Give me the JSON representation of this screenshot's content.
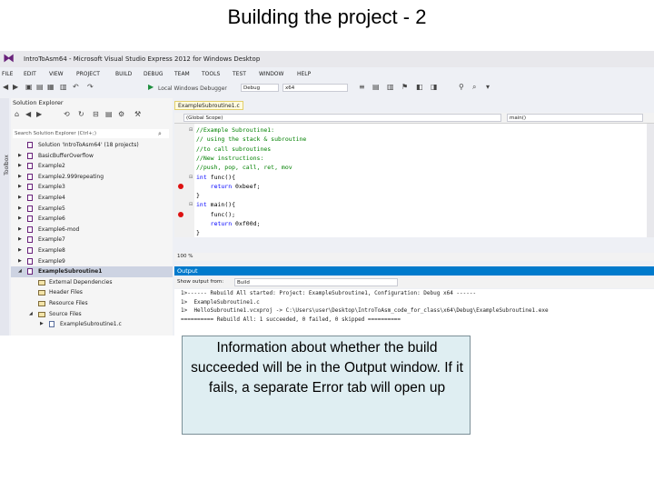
{
  "slide": {
    "title": "Building the project - 2",
    "callout": "Information about whether the build succeeded will be in the Output window. If it fails, a separate Error tab will open up"
  },
  "window": {
    "title": "IntroToAsm64 - Microsoft Visual Studio Express 2012 for Windows Desktop",
    "logo_icon": "visual-studio-logo"
  },
  "menu": [
    "FILE",
    "EDIT",
    "VIEW",
    "PROJECT",
    "BUILD",
    "DEBUG",
    "TEAM",
    "TOOLS",
    "TEST",
    "WINDOW",
    "HELP"
  ],
  "toolbar": {
    "debugger": "Local Windows Debugger",
    "config": "Debug",
    "platform": "x64"
  },
  "toolbox": {
    "label": "Toolbox"
  },
  "solution_explorer": {
    "title": "Solution Explorer",
    "search_placeholder": "Search Solution Explorer (Ctrl+;)",
    "items": [
      {
        "label": "Solution 'IntroToAsm64' (18 projects)",
        "level": 0,
        "kind": "solution",
        "expander": ""
      },
      {
        "label": "BasicBufferOverflow",
        "level": 0,
        "kind": "project",
        "expander": "▶"
      },
      {
        "label": "Example2",
        "level": 0,
        "kind": "project",
        "expander": "▶"
      },
      {
        "label": "Example2.999repeating",
        "level": 0,
        "kind": "project",
        "expander": "▶"
      },
      {
        "label": "Example3",
        "level": 0,
        "kind": "project",
        "expander": "▶"
      },
      {
        "label": "Example4",
        "level": 0,
        "kind": "project",
        "expander": "▶"
      },
      {
        "label": "Example5",
        "level": 0,
        "kind": "project",
        "expander": "▶"
      },
      {
        "label": "Example6",
        "level": 0,
        "kind": "project",
        "expander": "▶"
      },
      {
        "label": "Example6-mod",
        "level": 0,
        "kind": "project",
        "expander": "▶"
      },
      {
        "label": "Example7",
        "level": 0,
        "kind": "project",
        "expander": "▶"
      },
      {
        "label": "Example8",
        "level": 0,
        "kind": "project",
        "expander": "▶"
      },
      {
        "label": "Example9",
        "level": 0,
        "kind": "project",
        "expander": "▶"
      },
      {
        "label": "ExampleSubroutine1",
        "level": 0,
        "kind": "project",
        "expander": "◢",
        "selected": true
      },
      {
        "label": "External Dependencies",
        "level": 1,
        "kind": "folder",
        "expander": ""
      },
      {
        "label": "Header Files",
        "level": 1,
        "kind": "folder",
        "expander": ""
      },
      {
        "label": "Resource Files",
        "level": 1,
        "kind": "folder",
        "expander": ""
      },
      {
        "label": "Source Files",
        "level": 1,
        "kind": "folder",
        "expander": "◢"
      },
      {
        "label": "ExampleSubroutine1.c",
        "level": 2,
        "kind": "file",
        "expander": "▶"
      }
    ]
  },
  "editor": {
    "tab": "ExampleSubroutine1.c",
    "scope": "(Global Scope)",
    "function": "main()",
    "zoom": "100 %",
    "lines": [
      {
        "text": "//Example Subroutine1:",
        "kind": "comment",
        "outline": "⊟"
      },
      {
        "text": "// using the stack & subroutine",
        "kind": "comment",
        "outline": ""
      },
      {
        "text": "//to call subroutines",
        "kind": "comment",
        "outline": ""
      },
      {
        "text": "//New instructions:",
        "kind": "comment",
        "outline": ""
      },
      {
        "text": "//push, pop, call, ret, mov",
        "kind": "comment",
        "outline": ""
      },
      {
        "text": "int func(){",
        "kind": "code",
        "outline": "⊟"
      },
      {
        "text": "    return 0xbeef;",
        "kind": "code",
        "outline": "",
        "breakpoint": true
      },
      {
        "text": "}",
        "kind": "code",
        "outline": ""
      },
      {
        "text": "int main(){",
        "kind": "code",
        "outline": "⊟"
      },
      {
        "text": "    func();",
        "kind": "code",
        "outline": "",
        "breakpoint": true
      },
      {
        "text": "    return 0xf00d;",
        "kind": "code",
        "outline": ""
      },
      {
        "text": "}",
        "kind": "code",
        "outline": ""
      }
    ]
  },
  "output": {
    "title": "Output",
    "show_label": "Show output from:",
    "source": "Build",
    "lines": [
      "1>------ Rebuild All started: Project: ExampleSubroutine1, Configuration: Debug x64 ------",
      "1>  ExampleSubroutine1.c",
      "1>  HelloSubroutine1.vcxproj -> C:\\Users\\user\\Desktop\\IntroToAsm_code_for_class\\x64\\Debug\\ExampleSubroutine1.exe",
      "========== Rebuild All: 1 succeeded, 0 failed, 0 skipped =========="
    ]
  },
  "colors": {
    "output_header": "#007acc",
    "breakpoint": "#dd1111",
    "comment": "#008000",
    "keyword": "#0000ff",
    "callout_bg": "#dfeef2"
  }
}
